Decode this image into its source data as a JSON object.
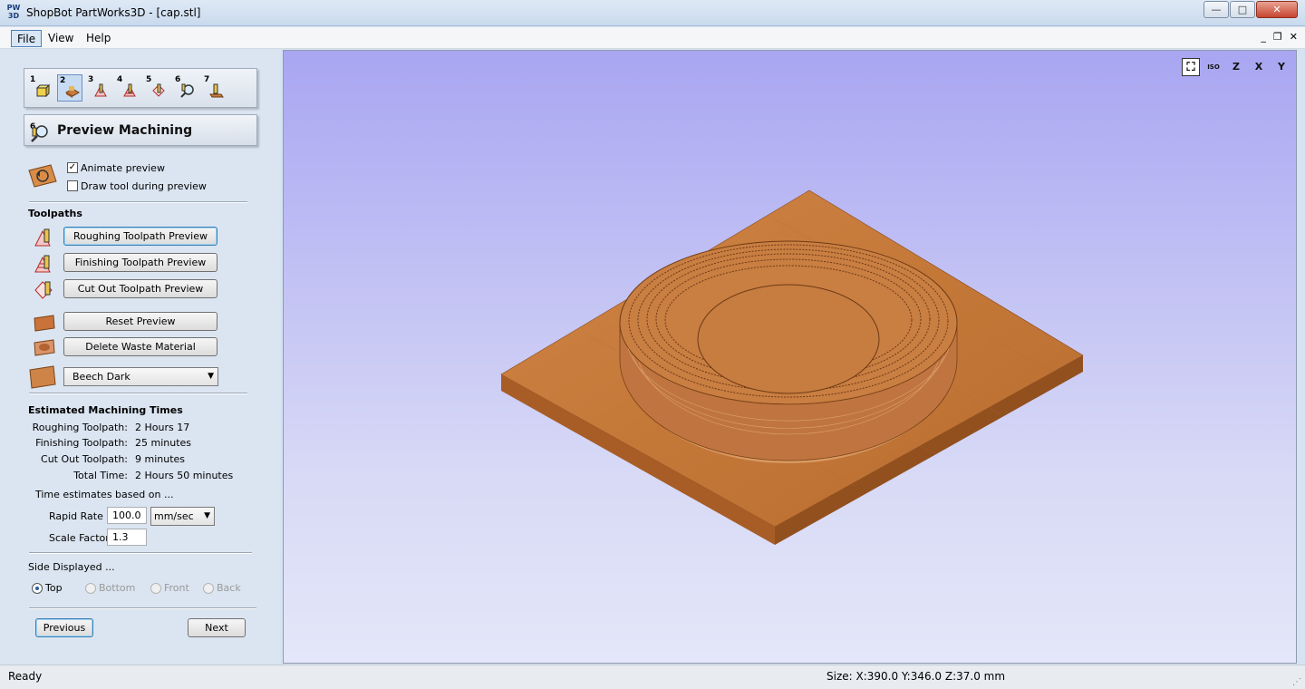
{
  "window": {
    "logo_text": "PW\n3D",
    "title": "ShopBot PartWorks3D - [cap.stl]",
    "minimize_glyph": "—",
    "maximize_glyph": "□",
    "close_glyph": "✕"
  },
  "menu": {
    "items": [
      "File",
      "View",
      "Help"
    ],
    "mdi_minimize": "_",
    "mdi_restore": "❐",
    "mdi_close": "✕"
  },
  "tabs": {
    "numbers": [
      "1",
      "2",
      "3",
      "4",
      "5",
      "6",
      "7"
    ],
    "selected_index": 1
  },
  "panel": {
    "title": "Preview Machining",
    "title_icon_number": "6",
    "animate_preview_label": "Animate preview",
    "animate_preview_checked": true,
    "draw_tool_label": "Draw tool during preview",
    "draw_tool_checked": false,
    "check_glyph": "✓",
    "toolpaths_title": "Toolpaths",
    "roughing_btn": "Roughing Toolpath Preview",
    "finishing_btn": "Finishing Toolpath Preview",
    "cutout_btn": "Cut Out Toolpath Preview",
    "reset_btn": "Reset Preview",
    "delete_waste_btn": "Delete Waste Material",
    "material_select": "Beech Dark",
    "caret_glyph": "▼",
    "times_title": "Estimated Machining Times",
    "times": [
      {
        "label": "Roughing Toolpath:",
        "value": "2 Hours 17"
      },
      {
        "label": "Finishing Toolpath:",
        "value": "25 minutes"
      },
      {
        "label": "Cut Out Toolpath:",
        "value": "9 minutes"
      },
      {
        "label": "Total Time:",
        "value": "2 Hours 50 minutes"
      }
    ],
    "estimates_note": "Time estimates based on ...",
    "rapid_rate_label": "Rapid Rate",
    "rapid_rate_value": "100.0",
    "rapid_rate_unit": "mm/sec",
    "scale_factor_label": "Scale Factor",
    "scale_factor_value": "1.3",
    "side_title": "Side Displayed ...",
    "sides": [
      {
        "label": "Top",
        "selected": true,
        "enabled": true
      },
      {
        "label": "Bottom",
        "selected": false,
        "enabled": false
      },
      {
        "label": "Front",
        "selected": false,
        "enabled": false
      },
      {
        "label": "Back",
        "selected": false,
        "enabled": false
      }
    ],
    "previous_btn": "Previous",
    "next_btn": "Next"
  },
  "viewport": {
    "view_buttons": [
      "⛶",
      "ISO",
      "Z",
      "X",
      "Y"
    ],
    "colors": {
      "wood_top": "#c97a3e",
      "wood_side": "#a95e27",
      "wood_dark": "#8c4c1e"
    }
  },
  "status": {
    "left": "Ready",
    "right": "Size: X:390.0 Y:346.0 Z:37.0 mm",
    "grip": "⋰"
  }
}
